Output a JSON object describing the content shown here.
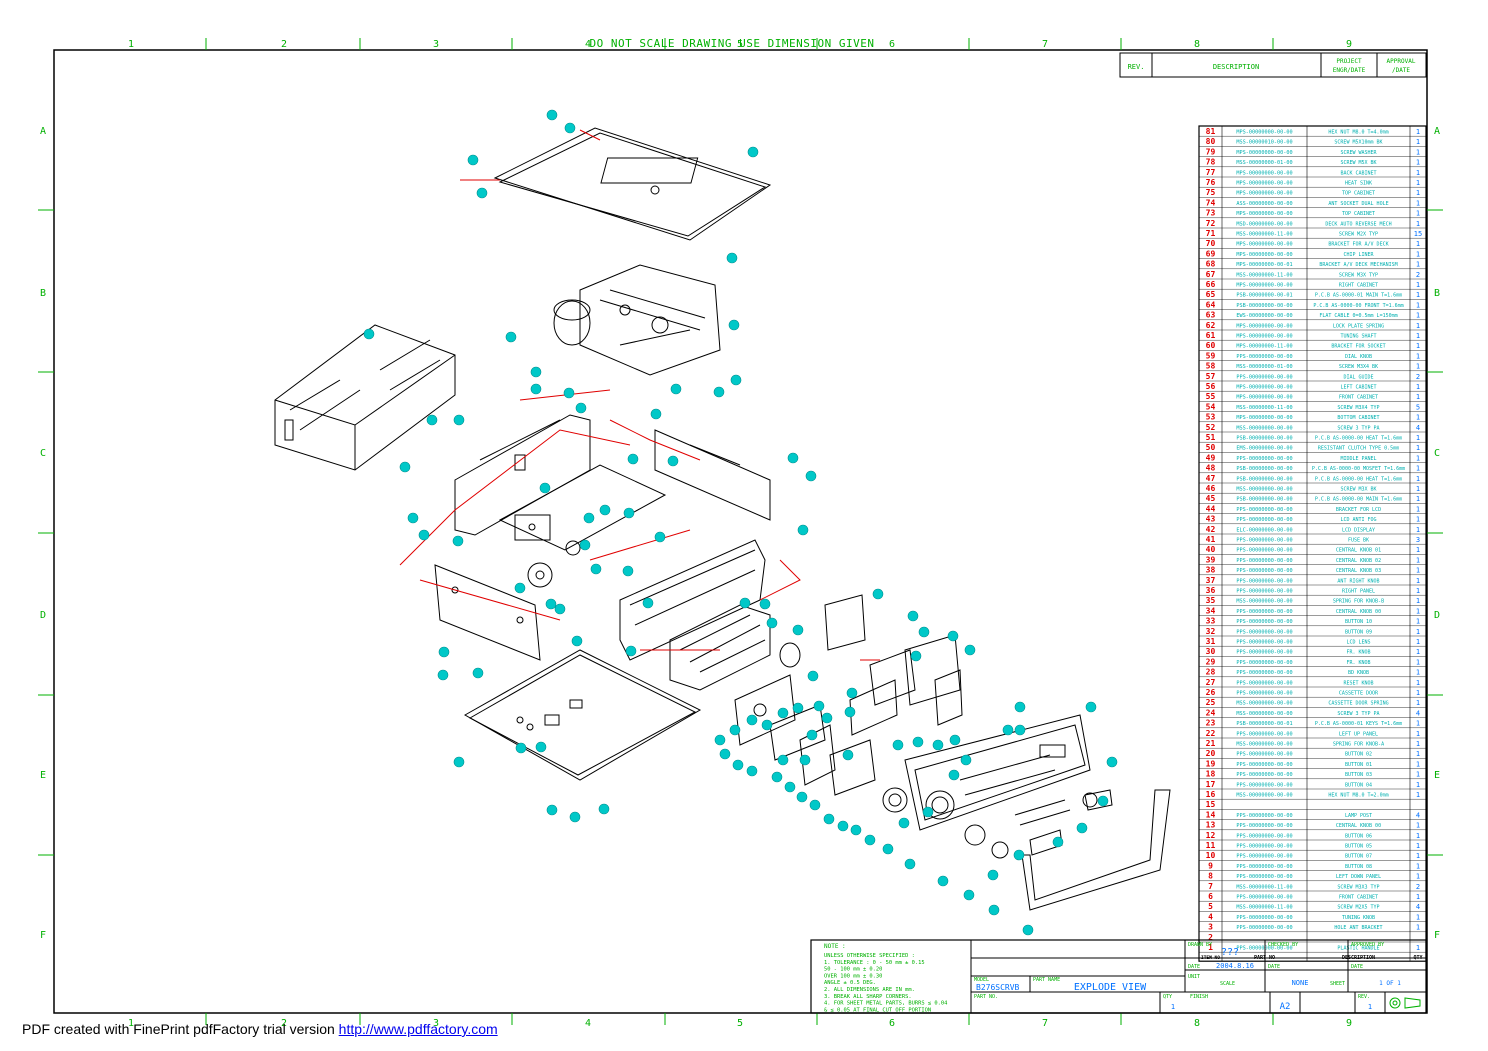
{
  "sheet": {
    "header_note": "DO NOT SCALE DRAWING   USE DIMENSION GIVEN",
    "columns": [
      "1",
      "2",
      "3",
      "4",
      "5",
      "6",
      "7",
      "8",
      "9"
    ],
    "rows": [
      "A",
      "B",
      "C",
      "D",
      "E",
      "F"
    ]
  },
  "revision_block": {
    "rev": "REV.",
    "description": "DESCRIPTION",
    "project": "PROJECT ENGR/DATE",
    "approval": "APPROVAL /DATE"
  },
  "bom": {
    "headers": {
      "item": "ITEM NO",
      "part": "PART NO",
      "desc": "DESCRIPTION",
      "qty": "QTY"
    },
    "items": [
      {
        "no": "81",
        "part": "MPS-00000000-00-00",
        "desc": "HEX NUT M8.0 T=4.0mm",
        "qty": "1"
      },
      {
        "no": "80",
        "part": "MSS-00000010-00-00",
        "desc": "SCREW M5X10mm BK",
        "qty": "1"
      },
      {
        "no": "79",
        "part": "MPS-00000000-00-00",
        "desc": "SCREW WASHER",
        "qty": "1"
      },
      {
        "no": "78",
        "part": "MSS-00000000-01-00",
        "desc": "SCREW M5X BK",
        "qty": "1"
      },
      {
        "no": "77",
        "part": "MPS-00000000-00-00",
        "desc": "BACK CABINET",
        "qty": "1"
      },
      {
        "no": "76",
        "part": "MPS-00000000-00-00",
        "desc": "HEAT SINK",
        "qty": "1"
      },
      {
        "no": "75",
        "part": "MPS-00000000-00-00",
        "desc": "TOP CABINET",
        "qty": "1"
      },
      {
        "no": "74",
        "part": "ASS-00000000-00-00",
        "desc": "ANT SOCKET DUAL HOLE",
        "qty": "1"
      },
      {
        "no": "73",
        "part": "MPS-00000000-00-00",
        "desc": "TOP CABINET",
        "qty": "1"
      },
      {
        "no": "72",
        "part": "MSD-00000000-00-00",
        "desc": "DECK AUTO REVERSE MECH",
        "qty": "1"
      },
      {
        "no": "71",
        "part": "MSS-00000000-11-00",
        "desc": "SCREW M2X TYP",
        "qty": "15"
      },
      {
        "no": "70",
        "part": "MPS-00000000-00-00",
        "desc": "BRACKET FOR A/V DECK",
        "qty": "1"
      },
      {
        "no": "69",
        "part": "MPS-00000000-00-00",
        "desc": "CHIP LINER",
        "qty": "1"
      },
      {
        "no": "68",
        "part": "MPS-00000000-00-01",
        "desc": "BRACKET A/V DECK MECHANISM",
        "qty": "1"
      },
      {
        "no": "67",
        "part": "MSS-00000000-11-00",
        "desc": "SCREW M3X TYP",
        "qty": "2"
      },
      {
        "no": "66",
        "part": "MPS-00000000-00-00",
        "desc": "RIGHT CABINET",
        "qty": "1"
      },
      {
        "no": "65",
        "part": "PSB-00000000-00-01",
        "desc": "P.C.B AS-0000-01 MAIN T=1.6mm",
        "qty": "1"
      },
      {
        "no": "64",
        "part": "PSB-00000000-00-00",
        "desc": "P.C.B AS-0000-00 FRONT T=1.6mm",
        "qty": "1"
      },
      {
        "no": "63",
        "part": "EWS-00000000-00-00",
        "desc": "FLAT CABLE 0=0.5mm L=150mm",
        "qty": "1"
      },
      {
        "no": "62",
        "part": "MPS-00000000-00-00",
        "desc": "LOCK PLATE SPRING",
        "qty": "1"
      },
      {
        "no": "61",
        "part": "MPS-00000000-00-00",
        "desc": "TUNING SHAFT",
        "qty": "1"
      },
      {
        "no": "60",
        "part": "MPS-00000000-11-00",
        "desc": "BRACKET FOR SOCKET",
        "qty": "1"
      },
      {
        "no": "59",
        "part": "PPS-00000000-00-00",
        "desc": "DIAL KNOB",
        "qty": "1"
      },
      {
        "no": "58",
        "part": "MSS-00000000-01-00",
        "desc": "SCREW M3X4 BK",
        "qty": "1"
      },
      {
        "no": "57",
        "part": "PPS-00000000-00-00",
        "desc": "DIAL GUIDE",
        "qty": "2"
      },
      {
        "no": "56",
        "part": "MPS-00000000-00-00",
        "desc": "LEFT CABINET",
        "qty": "1"
      },
      {
        "no": "55",
        "part": "MPS-00000000-00-00",
        "desc": "FRONT CABINET",
        "qty": "1"
      },
      {
        "no": "54",
        "part": "MSS-00000000-11-00",
        "desc": "SCREW M3X4 TYP",
        "qty": "5"
      },
      {
        "no": "53",
        "part": "MPS-00000000-00-00",
        "desc": "BOTTOM CABINET",
        "qty": "1"
      },
      {
        "no": "52",
        "part": "MSS-00000000-00-00",
        "desc": "SCREW 3 TYP PA",
        "qty": "4"
      },
      {
        "no": "51",
        "part": "PSB-00000000-00-00",
        "desc": "P.C.B AS-0000-00 HEAT T=1.6mm",
        "qty": "1"
      },
      {
        "no": "50",
        "part": "EMS-00000000-00-00",
        "desc": "RESISTANT CLUTCH TYPE 0.5mm",
        "qty": "1"
      },
      {
        "no": "49",
        "part": "PPS-00000000-00-00",
        "desc": "MIDDLE PANEL",
        "qty": "1"
      },
      {
        "no": "48",
        "part": "PSB-00000000-00-00",
        "desc": "P.C.B AS-0000-00 MOSFET T=1.6mm",
        "qty": "1"
      },
      {
        "no": "47",
        "part": "PSB-00000000-00-00",
        "desc": "P.C.B AS-0000-00 HEAT T=1.6mm",
        "qty": "1"
      },
      {
        "no": "46",
        "part": "MSS-00000000-00-00",
        "desc": "SCREW M3X BK",
        "qty": "1"
      },
      {
        "no": "45",
        "part": "PSB-00000000-00-00",
        "desc": "P.C.B AS-0000-00 MAIN T=1.6mm",
        "qty": "1"
      },
      {
        "no": "44",
        "part": "PPS-00000000-00-00",
        "desc": "BRACKET FOR LCD",
        "qty": "1"
      },
      {
        "no": "43",
        "part": "PPS-00000000-00-00",
        "desc": "LCD ANTI FOG",
        "qty": "1"
      },
      {
        "no": "42",
        "part": "ELC-00000000-00-00",
        "desc": "LCD DISPLAY",
        "qty": "1"
      },
      {
        "no": "41",
        "part": "PPS-00000000-00-00",
        "desc": "FUSE BK",
        "qty": "3"
      },
      {
        "no": "40",
        "part": "PPS-00000000-00-00",
        "desc": "CENTRAL KNOB 01",
        "qty": "1"
      },
      {
        "no": "39",
        "part": "PPS-00000000-00-00",
        "desc": "CENTRAL KNOB 02",
        "qty": "1"
      },
      {
        "no": "38",
        "part": "PPS-00000000-00-00",
        "desc": "CENTRAL KNOB 03",
        "qty": "1"
      },
      {
        "no": "37",
        "part": "PPS-00000000-00-00",
        "desc": "ANT RIGHT KNOB",
        "qty": "1"
      },
      {
        "no": "36",
        "part": "PPS-00000000-00-00",
        "desc": "RIGHT PANEL",
        "qty": "1"
      },
      {
        "no": "35",
        "part": "MSS-00000000-00-00",
        "desc": "SPRING FOR KNOB-B",
        "qty": "1"
      },
      {
        "no": "34",
        "part": "PPS-00000000-00-00",
        "desc": "CENTRAL KNOB 00",
        "qty": "1"
      },
      {
        "no": "33",
        "part": "PPS-00000000-00-00",
        "desc": "BUTTON 10",
        "qty": "1"
      },
      {
        "no": "32",
        "part": "PPS-00000000-00-00",
        "desc": "BUTTON 09",
        "qty": "1"
      },
      {
        "no": "31",
        "part": "PPS-00000000-00-00",
        "desc": "LCD LENS",
        "qty": "1"
      },
      {
        "no": "30",
        "part": "PPS-00000000-00-00",
        "desc": "FR. KNOB",
        "qty": "1"
      },
      {
        "no": "29",
        "part": "PPS-00000000-00-00",
        "desc": "FR. KNOB",
        "qty": "1"
      },
      {
        "no": "28",
        "part": "PPS-00000000-00-00",
        "desc": "BD KNOB",
        "qty": "1"
      },
      {
        "no": "27",
        "part": "PPS-00000000-00-00",
        "desc": "RESET KNOB",
        "qty": "1"
      },
      {
        "no": "26",
        "part": "PPS-00000000-00-00",
        "desc": "CASSETTE DOOR",
        "qty": "1"
      },
      {
        "no": "25",
        "part": "MSS-00000000-00-00",
        "desc": "CASSETTE DOOR SPRING",
        "qty": "1"
      },
      {
        "no": "24",
        "part": "MSS-00000000-00-00",
        "desc": "SCREW 3 TYP PA",
        "qty": "4"
      },
      {
        "no": "23",
        "part": "PSB-00000000-00-01",
        "desc": "P.C.B AS-0000-01 KEYS T=1.6mm",
        "qty": "1"
      },
      {
        "no": "22",
        "part": "PPS-00000000-00-00",
        "desc": "LEFT UP PANEL",
        "qty": "1"
      },
      {
        "no": "21",
        "part": "MSS-00000000-00-00",
        "desc": "SPRING FOR KNOB-A",
        "qty": "1"
      },
      {
        "no": "20",
        "part": "PPS-00000000-00-00",
        "desc": "BUTTON 02",
        "qty": "1"
      },
      {
        "no": "19",
        "part": "PPS-00000000-00-00",
        "desc": "BUTTON 01",
        "qty": "1"
      },
      {
        "no": "18",
        "part": "PPS-00000000-00-00",
        "desc": "BUTTON 03",
        "qty": "1"
      },
      {
        "no": "17",
        "part": "PPS-00000000-00-00",
        "desc": "BUTTON 04",
        "qty": "1"
      },
      {
        "no": "16",
        "part": "MSS-00000000-00-00",
        "desc": "HEX NUT M8.0 T=2.0mm",
        "qty": "1"
      },
      {
        "no": "15",
        "part": "",
        "desc": "",
        "qty": ""
      },
      {
        "no": "14",
        "part": "PPS-00000000-00-00",
        "desc": "LAMP POST",
        "qty": "4"
      },
      {
        "no": "13",
        "part": "PPS-00000000-00-00",
        "desc": "CENTRAL KNOB 00",
        "qty": "1"
      },
      {
        "no": "12",
        "part": "PPS-00000000-00-00",
        "desc": "BUTTON 06",
        "qty": "1"
      },
      {
        "no": "11",
        "part": "PPS-00000000-00-00",
        "desc": "BUTTON 05",
        "qty": "1"
      },
      {
        "no": "10",
        "part": "PPS-00000000-00-00",
        "desc": "BUTTON 07",
        "qty": "1"
      },
      {
        "no": "9",
        "part": "PPS-00000000-00-00",
        "desc": "BUTTON 08",
        "qty": "1"
      },
      {
        "no": "8",
        "part": "PPS-00000000-00-00",
        "desc": "LEFT DOWN PANEL",
        "qty": "1"
      },
      {
        "no": "7",
        "part": "MSS-00000000-11-00",
        "desc": "SCREW M3X3 TYP",
        "qty": "2"
      },
      {
        "no": "6",
        "part": "PPS-00000000-00-00",
        "desc": "FRONT CABINET",
        "qty": "1"
      },
      {
        "no": "5",
        "part": "MSS-00000000-11-00",
        "desc": "SCREW M2X5 TYP",
        "qty": "4"
      },
      {
        "no": "4",
        "part": "PPS-00000000-00-00",
        "desc": "TUNING KNOB",
        "qty": "1"
      },
      {
        "no": "3",
        "part": "PPS-00000000-00-00",
        "desc": "HOLE ANT BRACKET",
        "qty": "1"
      },
      {
        "no": "2",
        "part": "",
        "desc": "",
        "qty": ""
      },
      {
        "no": "1",
        "part": "PPS-00000000-00-00",
        "desc": "PLASTIC HANDLE",
        "qty": "1"
      }
    ]
  },
  "title_block": {
    "note_title": "NOTE :",
    "notes": [
      "UNLESS OTHERWISE SPECIFIED :",
      "1. TOLERANCE :  0  -  50  mm ± 0.15",
      "               50  - 100  mm ± 0.20",
      "              OVER   100  mm ± 0.30",
      "              ANGLE    ± 0.5  DEG.",
      "2. ALL DIMENSIONS ARE IN mm.",
      "3. BREAK ALL SHARP CORNERS.",
      "4. FOR SHEET METAL PARTS, BURRS ≤ 0.04",
      "   & ≤ 0.05 AT FINAL CUT OFF PORTION"
    ],
    "drawn_by_label": "DRAWN BY",
    "drawn_by": "???",
    "checked_by_label": "CHECKED BY",
    "approved_by_label": "APPROVED BY",
    "date_label": "DATE",
    "date": "2004.8.16",
    "date2_label": "DATE",
    "date3_label": "DATE",
    "model_label": "MODEL",
    "model": "B276SCRVB",
    "part_name_label": "PART NAME",
    "part_name": "EXPLODE VIEW",
    "unit_label": "UNIT",
    "scale_label": "SCALE",
    "scale": "NONE",
    "sheet_label": "SHEET",
    "sheet": "1  OF  1",
    "part_no_label": "PART NO.",
    "qty_label": "QTY",
    "qty": "1",
    "finish_label": "FINISH",
    "size": "A2",
    "rev_label": "REV.",
    "rev": "1"
  },
  "footer": {
    "text": "PDF created with FinePrint pdfFactory trial version ",
    "link": "http://www.pdffactory.com"
  }
}
